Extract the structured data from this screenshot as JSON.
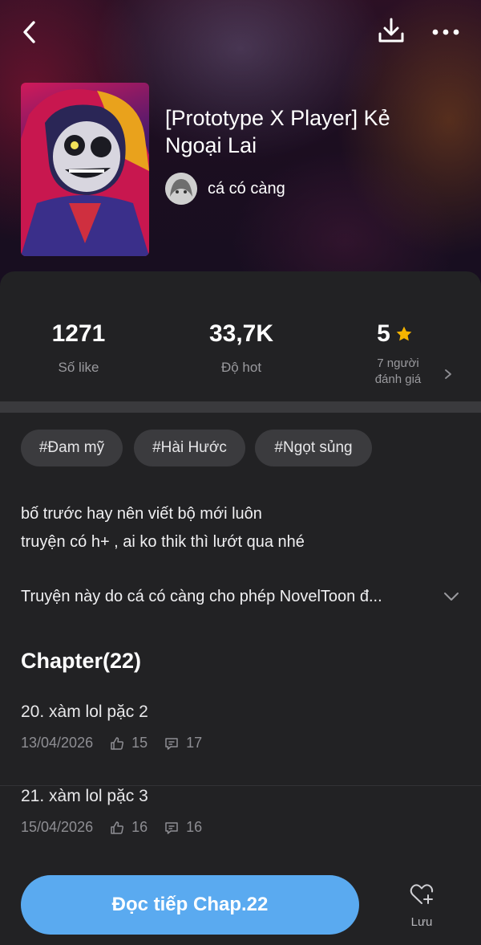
{
  "header": {
    "back_icon": "chevron-left-icon",
    "download_icon": "download-icon",
    "more_icon": "more-dots-icon"
  },
  "book": {
    "title": "[Prototype X Player] Kẻ Ngoại Lai",
    "author": "cá có càng"
  },
  "stats": {
    "likes_value": "1271",
    "likes_label": "Số like",
    "hot_value": "33,7K",
    "hot_label": "Độ hot",
    "rating_value": "5",
    "rating_label_line1": "7 người",
    "rating_label_line2": "đánh giá"
  },
  "tags": [
    "#Đam mỹ",
    "#Hài Hước",
    "#Ngọt sủng"
  ],
  "description": {
    "line1": "bố trước hay nên viết bộ mới luôn",
    "line2": "truyện có h+ , ai ko thik thì lướt qua nhé",
    "permission": "Truyện này do cá có càng cho phép NovelToon đ..."
  },
  "chapters": {
    "heading": "Chapter(22)",
    "items": [
      {
        "title": "20. xàm lol pặc 2",
        "date": "13/04/2026",
        "likes": "15",
        "comments": "17"
      },
      {
        "title": "21. xàm lol pặc 3",
        "date": "15/04/2026",
        "likes": "16",
        "comments": "16"
      }
    ]
  },
  "footer": {
    "read_label": "Đọc tiếp Chap.22",
    "save_label": "Lưu"
  },
  "colors": {
    "background": "#222224",
    "accent": "#5aaaf0",
    "star": "#f5b400",
    "tag_bg": "#3b3b3e"
  }
}
